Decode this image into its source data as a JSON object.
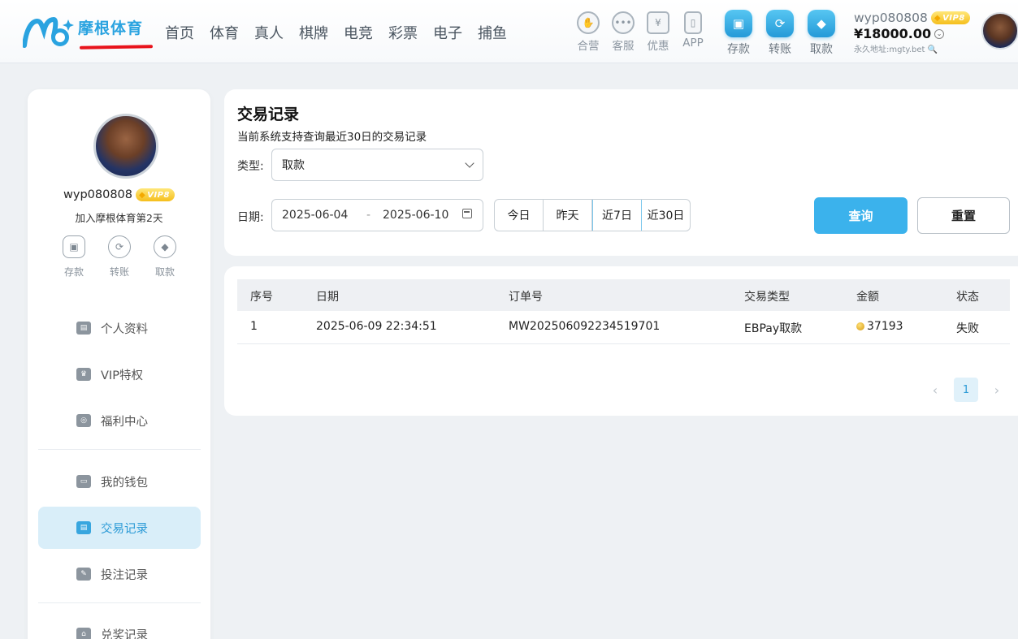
{
  "brand": {
    "name": "摩根体育"
  },
  "nav": [
    "首页",
    "体育",
    "真人",
    "棋牌",
    "电竞",
    "彩票",
    "电子",
    "捕鱼"
  ],
  "header_links": [
    {
      "label": "合营",
      "icon": "handshake-icon"
    },
    {
      "label": "客服",
      "icon": "chat-icon"
    },
    {
      "label": "优惠",
      "icon": "coupon-icon"
    },
    {
      "label": "APP",
      "icon": "phone-icon"
    }
  ],
  "header_actions": [
    {
      "label": "存款",
      "icon": "deposit-icon"
    },
    {
      "label": "转账",
      "icon": "transfer-icon"
    },
    {
      "label": "取款",
      "icon": "withdraw-icon"
    }
  ],
  "user": {
    "username": "wyp080808",
    "vip": "VIP8",
    "balance": "¥18000.00",
    "perm_address": "永久地址:mgty.bet"
  },
  "sidebar": {
    "join_text": "加入摩根体育第2天",
    "quick": [
      "存款",
      "转账",
      "取款"
    ],
    "items": [
      {
        "label": "个人资料",
        "icon": "id-card-icon"
      },
      {
        "label": "VIP特权",
        "icon": "crown-icon"
      },
      {
        "label": "福利中心",
        "icon": "gift-icon"
      },
      {
        "label": "我的钱包",
        "icon": "wallet-icon"
      },
      {
        "label": "交易记录",
        "icon": "transaction-icon",
        "active": true
      },
      {
        "label": "投注记录",
        "icon": "bet-record-icon"
      },
      {
        "label": "兑奖记录",
        "icon": "prize-icon"
      }
    ]
  },
  "filters": {
    "title": "交易记录",
    "subtitle": "当前系统支持查询最近30日的交易记录",
    "type_label": "类型:",
    "type_value": "取款",
    "date_label": "日期:",
    "date_start": "2025-06-04",
    "date_sep": "-",
    "date_end": "2025-06-10",
    "quick_dates": [
      "今日",
      "昨天",
      "近7日",
      "近30日"
    ],
    "quick_active": "近7日",
    "query_label": "查询",
    "reset_label": "重置"
  },
  "table": {
    "columns": [
      "序号",
      "日期",
      "订单号",
      "交易类型",
      "金额",
      "状态"
    ],
    "rows": [
      [
        "1",
        "2025-06-09 22:34:51",
        "MW202506092234519701",
        "EBPay取款",
        "37193",
        "失败"
      ]
    ]
  },
  "pagination": {
    "current": "1",
    "prev": "‹",
    "next": "›"
  }
}
